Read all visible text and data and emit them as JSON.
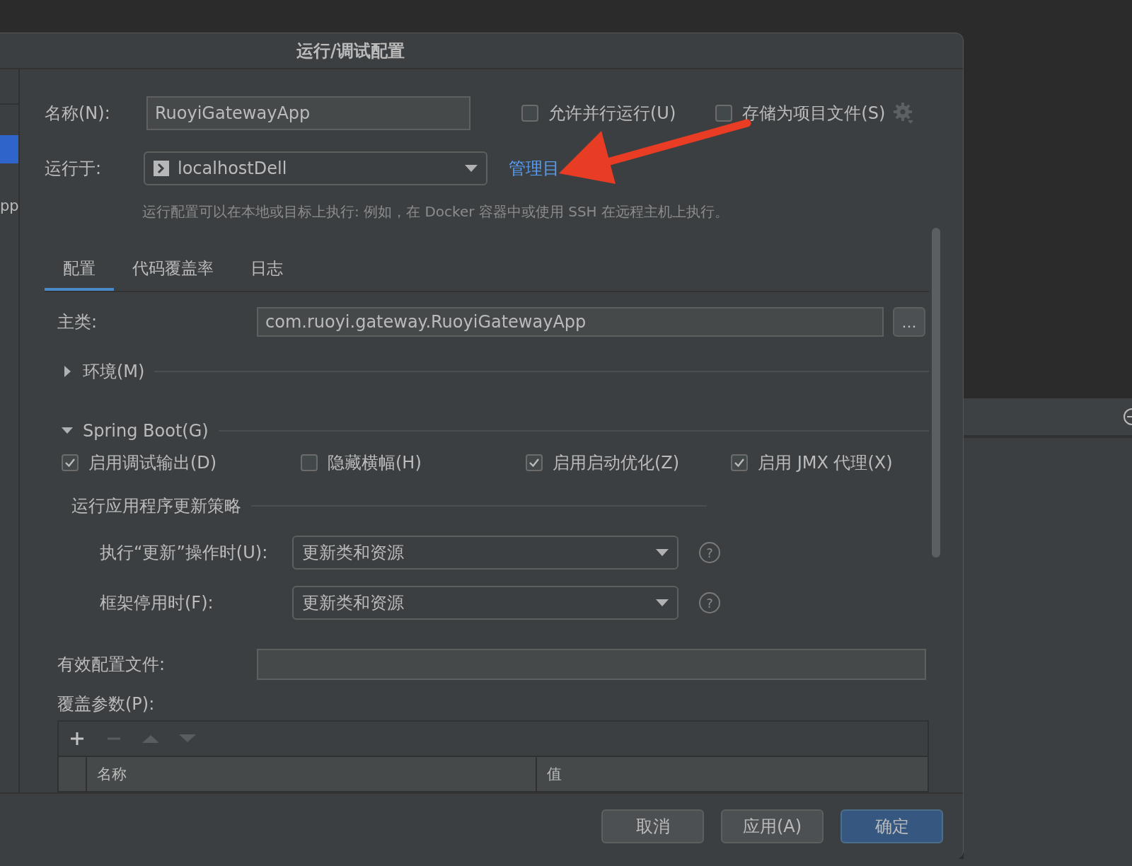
{
  "window": {
    "title": "运行/调试配置"
  },
  "sidebar": {
    "items": [
      {
        "selected": true
      },
      {
        "label": "pp",
        "selected": false
      }
    ]
  },
  "name_field": {
    "label": "名称(N):",
    "value": "RuoyiGatewayApp"
  },
  "options": [
    {
      "label": "允许并行运行(U)",
      "checked": false
    },
    {
      "label": "存储为项目文件(S)",
      "checked": false
    }
  ],
  "run_on": {
    "label": "运行于:",
    "value": "localhostDell",
    "link": "管理目"
  },
  "hint": "运行配置可以在本地或目标上执行: 例如，在 Docker 容器中或使用 SSH 在远程主机上执行。",
  "tabs": [
    {
      "label": "配置",
      "selected": true
    },
    {
      "label": "代码覆盖率",
      "selected": false
    },
    {
      "label": "日志",
      "selected": false
    }
  ],
  "main_class": {
    "label": "主类:",
    "value": "com.ruoyi.gateway.RuoyiGatewayApp",
    "browse": "..."
  },
  "environment": {
    "title": "环境(M)",
    "expanded": false
  },
  "spring_boot": {
    "title": "Spring Boot(G)",
    "expanded": true,
    "checkboxes": [
      {
        "label": "启用调试输出(D)",
        "checked": true
      },
      {
        "label": "隐藏横幅(H)",
        "checked": false
      },
      {
        "label": "启用启动优化(Z)",
        "checked": true
      },
      {
        "label": "启用 JMX 代理(X)",
        "checked": true
      }
    ],
    "update_policy": {
      "title": "运行应用程序更新策略",
      "rows": [
        {
          "label": "执行“更新”操作时(U):",
          "value": "更新类和资源",
          "help": "?"
        },
        {
          "label": "框架停用时(F):",
          "value": "更新类和资源",
          "help": "?"
        }
      ]
    }
  },
  "active_profiles": {
    "label": "有效配置文件:"
  },
  "override_parameters": {
    "label": "覆盖参数(P):",
    "toolbar": [
      {
        "kind": "add",
        "disabled": false
      },
      {
        "kind": "remove",
        "disabled": true
      },
      {
        "kind": "up",
        "disabled": true
      },
      {
        "kind": "down",
        "disabled": true
      }
    ],
    "columns": [
      "名称",
      "值"
    ]
  },
  "buttons": [
    {
      "label": "取消",
      "default": false
    },
    {
      "label": "应用(A)",
      "default": false
    },
    {
      "label": "确定",
      "default": true
    }
  ],
  "annotation_arrow": true
}
